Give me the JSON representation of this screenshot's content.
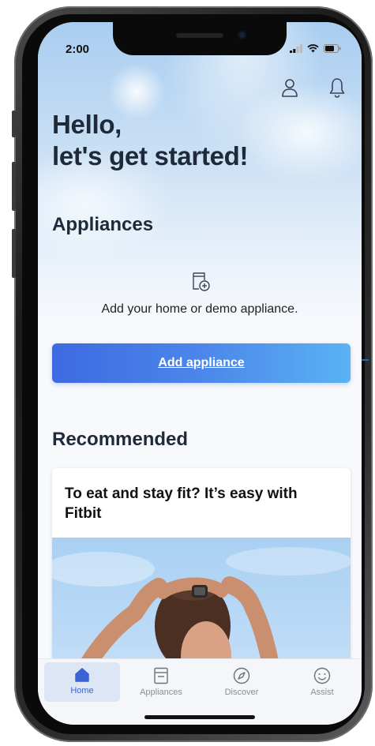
{
  "status_bar": {
    "time": "2:00"
  },
  "header": {
    "greeting_line1": "Hello,",
    "greeting_line2": "let's get started!",
    "profile_icon": "person-icon",
    "notification_icon": "bell-icon"
  },
  "appliances": {
    "title": "Appliances",
    "empty_text": "Add your home or demo appliance.",
    "add_button_label": "Add appliance",
    "accent_start": "#3e6ae1",
    "accent_end": "#5ab2f4"
  },
  "recommended": {
    "title": "Recommended",
    "card_title": "To eat and stay fit? It’s easy with Fitbit"
  },
  "tabbar": {
    "items": [
      {
        "label": "Home",
        "icon": "home-icon",
        "active": true
      },
      {
        "label": "Appliances",
        "icon": "appliance-icon",
        "active": false
      },
      {
        "label": "Discover",
        "icon": "compass-icon",
        "active": false
      },
      {
        "label": "Assist",
        "icon": "smiley-icon",
        "active": false
      }
    ],
    "active_color": "#3b63d6"
  }
}
